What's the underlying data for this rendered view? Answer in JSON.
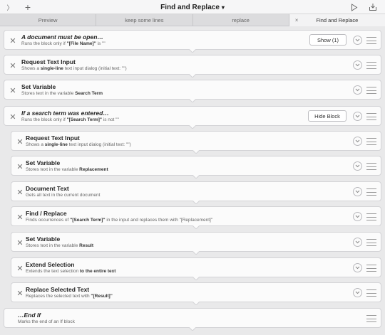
{
  "toolbar": {
    "title": "Find and Replace",
    "title_caret": "▾",
    "sidebar_glyph": "〉",
    "add_glyph": "+",
    "play_icon": "play-icon",
    "share_icon": "share-icon"
  },
  "tabs": [
    {
      "label": "Preview",
      "active": false
    },
    {
      "label": "keep some lines",
      "active": false
    },
    {
      "label": "replace",
      "active": false
    },
    {
      "label": "Find and Replace",
      "active": true,
      "close": "×"
    }
  ],
  "actions": [
    {
      "title": "A document must be open…",
      "italic": true,
      "sub": [
        "Runs the block only if ",
        "\"[File Name]\"",
        " is \"\""
      ],
      "button": "Show (1)",
      "collapse": true,
      "level": 0
    },
    {
      "title": "Request Text Input",
      "sub": [
        "Shows a ",
        "single-line",
        " text input dialog (initial text: \"\")"
      ],
      "level": 0
    },
    {
      "title": "Set Variable",
      "sub": [
        "Stores text in the variable ",
        "Search Term",
        ""
      ],
      "level": 0
    },
    {
      "title": "If a search term was entered…",
      "italic": true,
      "sub": [
        "Runs the block only if ",
        "\"[Search Term]\"",
        " is not \"\""
      ],
      "button": "Hide Block",
      "collapse": true,
      "level": 0
    },
    {
      "title": "Request Text Input",
      "sub": [
        "Shows a ",
        "single-line",
        " text input dialog (initial text: \"\")"
      ],
      "level": 1
    },
    {
      "title": "Set Variable",
      "sub": [
        "Stores text in the variable ",
        "Replacement",
        ""
      ],
      "level": 1
    },
    {
      "title": "Document Text",
      "sub": [
        "Gets all text in the current document",
        "",
        ""
      ],
      "level": 1
    },
    {
      "title": "Find / Replace",
      "sub": [
        "Finds occurrences of ",
        "\"[Search Term]\"",
        " in the input and replaces them with \"[Replacement]\""
      ],
      "level": 1
    },
    {
      "title": "Set Variable",
      "sub": [
        "Stores text in the variable ",
        "Result",
        ""
      ],
      "level": 1
    },
    {
      "title": "Extend Selection",
      "sub": [
        "Extends the text selection ",
        "to the entire text",
        ""
      ],
      "level": 1
    },
    {
      "title": "Replace Selected Text",
      "sub": [
        "Replaces the selected text with ",
        "\"[Result]\"",
        ""
      ],
      "level": 1
    },
    {
      "title": "…End If",
      "italic": true,
      "sub": [
        "Marks the end of an If block",
        "",
        ""
      ],
      "level": 0,
      "no_x": true,
      "no_collapse_btn": true
    }
  ],
  "icons": {
    "remove": "close-icon",
    "expand": "chevron-down-icon",
    "reorder": "drag-handle-icon"
  }
}
